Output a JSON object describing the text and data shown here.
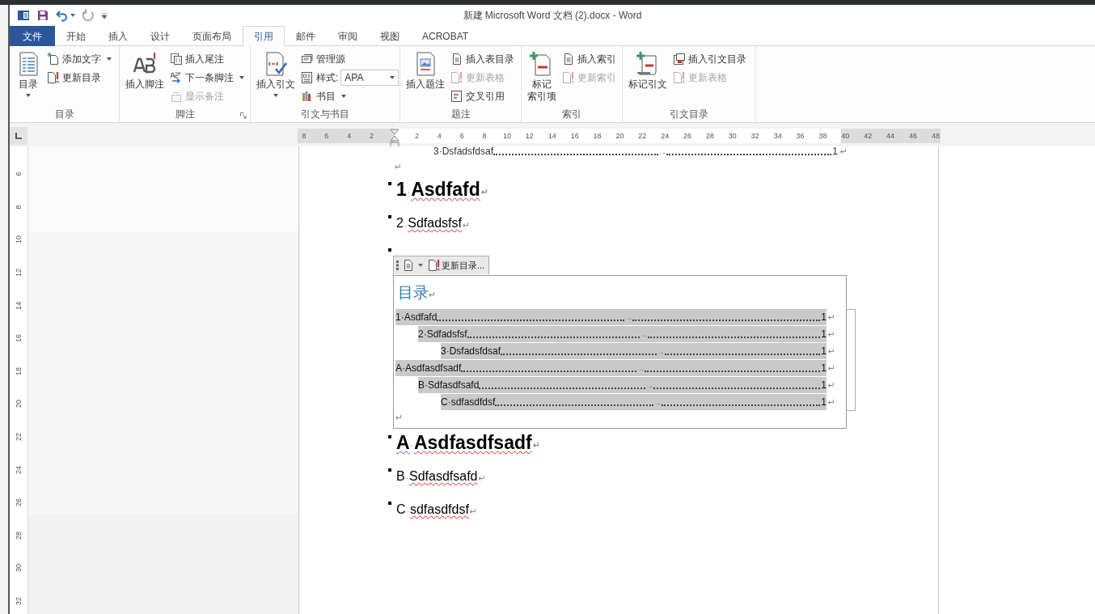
{
  "window": {
    "title": "新建 Microsoft Word 文档 (2).docx - Word"
  },
  "tabs": [
    {
      "label": "文件",
      "kind": "file",
      "selected": false
    },
    {
      "label": "开始",
      "kind": "tab",
      "selected": false
    },
    {
      "label": "插入",
      "kind": "tab",
      "selected": false
    },
    {
      "label": "设计",
      "kind": "tab",
      "selected": false
    },
    {
      "label": "页面布局",
      "kind": "tab",
      "selected": false
    },
    {
      "label": "引用",
      "kind": "tab",
      "selected": true
    },
    {
      "label": "邮件",
      "kind": "tab",
      "selected": false
    },
    {
      "label": "审阅",
      "kind": "tab",
      "selected": false
    },
    {
      "label": "视图",
      "kind": "tab",
      "selected": false
    },
    {
      "label": "ACROBAT",
      "kind": "tab",
      "selected": false
    }
  ],
  "ribbon": {
    "groups": [
      {
        "label": "目录",
        "big": {
          "lines": [
            "目录"
          ],
          "dropdown": true
        },
        "small": [
          {
            "kind": "button",
            "label": "添加文字",
            "dropdown": true,
            "disabled": false
          },
          {
            "kind": "button",
            "label": "更新目录",
            "disabled": false
          }
        ]
      },
      {
        "label": "脚注",
        "launcher": true,
        "big": {
          "lines": [
            "插入脚注"
          ]
        },
        "small": [
          {
            "kind": "button",
            "label": "插入尾注",
            "disabled": false
          },
          {
            "kind": "button",
            "label": "下一条脚注",
            "dropdown": true,
            "disabled": false
          },
          {
            "kind": "button",
            "label": "显示备注",
            "disabled": true
          }
        ]
      },
      {
        "label": "引文与书目",
        "big": {
          "lines": [
            "插入引文"
          ],
          "dropdown": true
        },
        "small": [
          {
            "kind": "button",
            "label": "管理源",
            "disabled": false
          },
          {
            "kind": "combo",
            "label": "样式:",
            "value": "APA"
          },
          {
            "kind": "button",
            "label": "书目",
            "dropdown": true,
            "disabled": false
          }
        ]
      },
      {
        "label": "题注",
        "big": {
          "lines": [
            "插入题注"
          ]
        },
        "small": [
          {
            "kind": "button",
            "label": "插入表目录",
            "disabled": false
          },
          {
            "kind": "button",
            "label": "更新表格",
            "disabled": true
          },
          {
            "kind": "button",
            "label": "交叉引用",
            "disabled": false
          }
        ]
      },
      {
        "label": "索引",
        "big": {
          "lines": [
            "标记",
            "索引项"
          ]
        },
        "small": [
          {
            "kind": "button",
            "label": "插入索引",
            "disabled": false
          },
          {
            "kind": "button",
            "label": "更新索引",
            "disabled": true
          }
        ]
      },
      {
        "label": "引文目录",
        "big": {
          "lines": [
            "标记引文"
          ]
        },
        "small": [
          {
            "kind": "button",
            "label": "插入引文目录",
            "disabled": false
          },
          {
            "kind": "button",
            "label": "更新表格",
            "disabled": true
          }
        ]
      }
    ]
  },
  "ruler": {
    "left_numbers": [
      "8",
      "6",
      "4",
      "2"
    ],
    "right_numbers": [
      "2",
      "4",
      "6",
      "8",
      "10",
      "12",
      "14",
      "16",
      "18",
      "20",
      "22",
      "24",
      "26",
      "28",
      "30",
      "32",
      "34",
      "36",
      "38",
      "40",
      "42",
      "44",
      "46",
      "48"
    ]
  },
  "vertical_ruler": {
    "numbers": [
      "6",
      "8",
      "10",
      "12",
      "14",
      "16",
      "18",
      "20",
      "22",
      "24",
      "26",
      "28",
      "30",
      "32"
    ]
  },
  "document": {
    "top_line": {
      "text": "3·Dsfadsfdsaf",
      "tab_mark": "→",
      "page": "1",
      "end_mark": "↵"
    },
    "blank_mark": "↵",
    "headings_before": [
      {
        "kind": "heading1",
        "number": "1",
        "separator": "·",
        "title": "Asdfafd",
        "misspelled": true,
        "number_grammar": false,
        "end_mark": "↵"
      },
      {
        "kind": "heading2",
        "number": "2",
        "separator": "·",
        "title": "Sdfadsfsf",
        "misspelled": true,
        "number_grammar": false,
        "end_mark": "↵"
      }
    ],
    "toc_toolbar": {
      "label": "更新目录..."
    },
    "toc": {
      "title": "目录",
      "title_mark": "↵",
      "end_mark": "↵",
      "entries": [
        {
          "text": "1·Asdfafd",
          "tab_mark": "→",
          "page": "1",
          "end_mark": "↵",
          "children": [
            {
              "text": "2·Sdfadsfsf",
              "tab_mark": "→",
              "page": "1",
              "end_mark": "↵",
              "children": [
                {
                  "text": "3·Dsfadsfdsaf",
                  "tab_mark": "→",
                  "page": "1",
                  "end_mark": "↵"
                }
              ]
            }
          ]
        },
        {
          "text": "A·Asdfasdfsadf",
          "tab_mark": "→",
          "page": "1",
          "end_mark": "↵",
          "children": [
            {
              "text": "B·Sdfasdfsafd",
              "tab_mark": "→",
              "page": "1",
              "end_mark": "↵",
              "children": [
                {
                  "text": "C·sdfasdfdsf",
                  "tab_mark": "→",
                  "page": "1",
                  "end_mark": "↵"
                }
              ]
            }
          ]
        }
      ]
    },
    "headings_after": [
      {
        "kind": "heading1",
        "number": "A",
        "separator": "·",
        "title": "Asdfasdfsadf",
        "misspelled": true,
        "number_grammar": true,
        "end_mark": "↵"
      },
      {
        "kind": "heading2",
        "number": "B",
        "separator": "·",
        "title": "Sdfasdfsafd",
        "misspelled": true,
        "number_grammar": false,
        "end_mark": "↵"
      },
      {
        "kind": "heading2",
        "number": "C",
        "separator": "·",
        "title": "sdfasdfdsf",
        "misspelled": true,
        "number_grammar": false,
        "end_mark": "↵"
      }
    ]
  }
}
